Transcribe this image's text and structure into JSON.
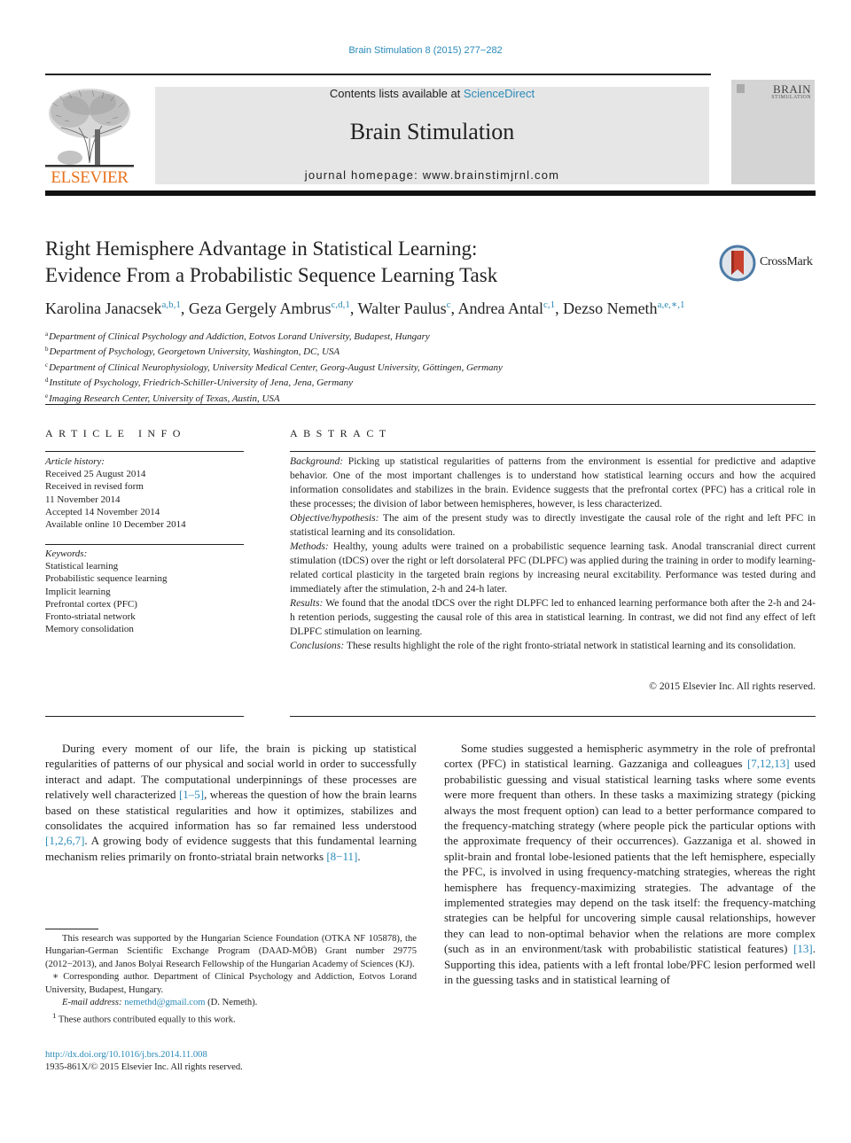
{
  "running_head": "Brain Stimulation 8 (2015) 277−282",
  "banner": {
    "contents_prefix": "Contents lists available at ",
    "contents_link": "ScienceDirect",
    "journal_name": "Brain Stimulation",
    "homepage": "journal homepage: www.brainstimjrnl.com"
  },
  "publisher_logo": {
    "wordmark": "ELSEVIER",
    "color": "#e9711c"
  },
  "cover": {
    "title": "BRAIN",
    "subtitle": "STIMULATION"
  },
  "article": {
    "title_line1": "Right Hemisphere Advantage in Statistical Learning:",
    "title_line2": "Evidence From a Probabilistic Sequence Learning Task",
    "crossmark_label": "CrossMark",
    "authors": [
      {
        "name": "Karolina Janacsek",
        "sup": "a,b,1"
      },
      {
        "name": "Geza Gergely Ambrus",
        "sup": "c,d,1"
      },
      {
        "name": "Walter Paulus",
        "sup": "c"
      },
      {
        "name": "Andrea Antal",
        "sup": "c,1"
      },
      {
        "name": "Dezso Nemeth",
        "sup": "a,e,∗,1"
      }
    ],
    "affiliations": [
      {
        "key": "a",
        "text": "Department of Clinical Psychology and Addiction, Eotvos Lorand University, Budapest, Hungary"
      },
      {
        "key": "b",
        "text": "Department of Psychology, Georgetown University, Washington, DC, USA"
      },
      {
        "key": "c",
        "text": "Department of Clinical Neurophysiology, University Medical Center, Georg-August University, Göttingen, Germany"
      },
      {
        "key": "d",
        "text": "Institute of Psychology, Friedrich-Schiller-University of Jena, Jena, Germany"
      },
      {
        "key": "e",
        "text": "Imaging Research Center, University of Texas, Austin, USA"
      }
    ]
  },
  "article_info": {
    "heading": "ARTICLE INFO",
    "history_label": "Article history:",
    "history": [
      "Received 25 August 2014",
      "Received in revised form",
      "11 November 2014",
      "Accepted 14 November 2014",
      "Available online 10 December 2014"
    ],
    "keywords_label": "Keywords:",
    "keywords": [
      "Statistical learning",
      "Probabilistic sequence learning",
      "Implicit learning",
      "Prefrontal cortex (PFC)",
      "Fronto-striatal network",
      "Memory consolidation"
    ]
  },
  "abstract": {
    "heading": "ABSTRACT",
    "sections": [
      {
        "label": "Background:",
        "text": " Picking up statistical regularities of patterns from the environment is essential for predictive and adaptive behavior. One of the most important challenges is to understand how statistical learning occurs and how the acquired information consolidates and stabilizes in the brain. Evidence suggests that the prefrontal cortex (PFC) has a critical role in these processes; the division of labor between hemi­spheres, however, is less characterized."
      },
      {
        "label": "Objective/hypothesis:",
        "text": " The aim of the present study was to directly investigate the causal role of the right and left PFC in statistical learning and its consolidation."
      },
      {
        "label": "Methods:",
        "text": " Healthy, young adults were trained on a probabilistic sequence learning task. Anodal transcranial direct current stimulation (tDCS) over the right or left dorsolateral PFC (DLPFC) was applied during the training in order to modify learning-related cortical plasticity in the targeted brain regions by increasing neural excitability. Performance was tested during and immediately after the stimulation, 2-h and 24-h later."
      },
      {
        "label": "Results:",
        "text": " We found that the anodal tDCS over the right DLPFC led to enhanced learning performance both after the 2-h and 24-h retention periods, suggesting the causal role of this area in statistical learning. In contrast, we did not find any effect of left DLPFC stimulation on learning."
      },
      {
        "label": "Conclusions:",
        "text": " These results highlight the role of the right fronto-striatal network in statistical learning and its consolidation."
      }
    ],
    "copyright": "© 2015 Elsevier Inc. All rights reserved."
  },
  "body": {
    "left_para": [
      {
        "t": "During every moment of our life, the brain is picking up statis­tical regularities of patterns of our physical and social world in order to successfully interact and adapt. The computational un­derpinnings of these processes are relatively well characterized "
      },
      {
        "ref": "[1–5]"
      },
      {
        "t": ", whereas the question of how the brain learns based on these statistical regularities and how it optimizes, stabilizes and consol­idates the acquired information has so far remained less under­stood "
      },
      {
        "ref": "[1,2,6,7]"
      },
      {
        "t": ". A growing body of evidence suggests that this fundamental learning mechanism relies primarily on fronto-striatal brain networks "
      },
      {
        "ref": "[8−11]"
      },
      {
        "t": "."
      }
    ],
    "right_para": [
      {
        "t": "Some studies suggested a hemispheric asymmetry in the role of prefrontal cortex (PFC) in statistical learning. Gazzaniga and col­leagues "
      },
      {
        "ref": "[7,12,13]"
      },
      {
        "t": " used probabilistic guessing and visual statistical learning tasks where some events were more frequent than others. In these tasks a maximizing strategy (picking always the most frequent option) can lead to a better performance compared to the frequency-matching strategy (where people pick the particular options with the approximate frequency of their occurrences). Gazzaniga et al. showed in split-brain and frontal lobe-lesioned patients that the left hemisphere, especially the PFC, is involved in using frequency-matching strategies, whereas the right hemi­sphere has frequency-maximizing strategies. The advantage of the implemented strategies may depend on the task itself: the frequency-matching strategies can be helpful for uncovering simple causal relationships, however they can lead to non-optimal behavior when the relations are more complex (such as in an environment/task with probabilistic statistical features) "
      },
      {
        "ref": "[13]"
      },
      {
        "t": ". Supporting this idea, patients with a left frontal lobe/PFC lesion performed well in the guessing tasks and in statistical learning of"
      }
    ]
  },
  "footnotes": {
    "funding": "This research was supported by the Hungarian Science Foundation (OTKA NF 105878), the Hungarian-German Scientific Exchange Program (DAAD-MÖB) Grant number 29775 (2012−2013), and Janos Bolyai Research Fellowship of the Hungarian Academy of Sciences (KJ).",
    "corresponding_mark": "∗",
    "corresponding": " Corresponding author. Department of Clinical Psychology and Addiction, Eotvos Lorand University, Budapest, Hungary.",
    "email_label": "E-mail address:",
    "email": "nemethd@gmail.com",
    "email_suffix": " (D. Nemeth).",
    "equal_mark": "1",
    "equal": " These authors contributed equally to this work."
  },
  "doi": "http://dx.doi.org/10.1016/j.brs.2014.11.008",
  "issn": "1935-861X/© 2015 Elsevier Inc. All rights reserved."
}
